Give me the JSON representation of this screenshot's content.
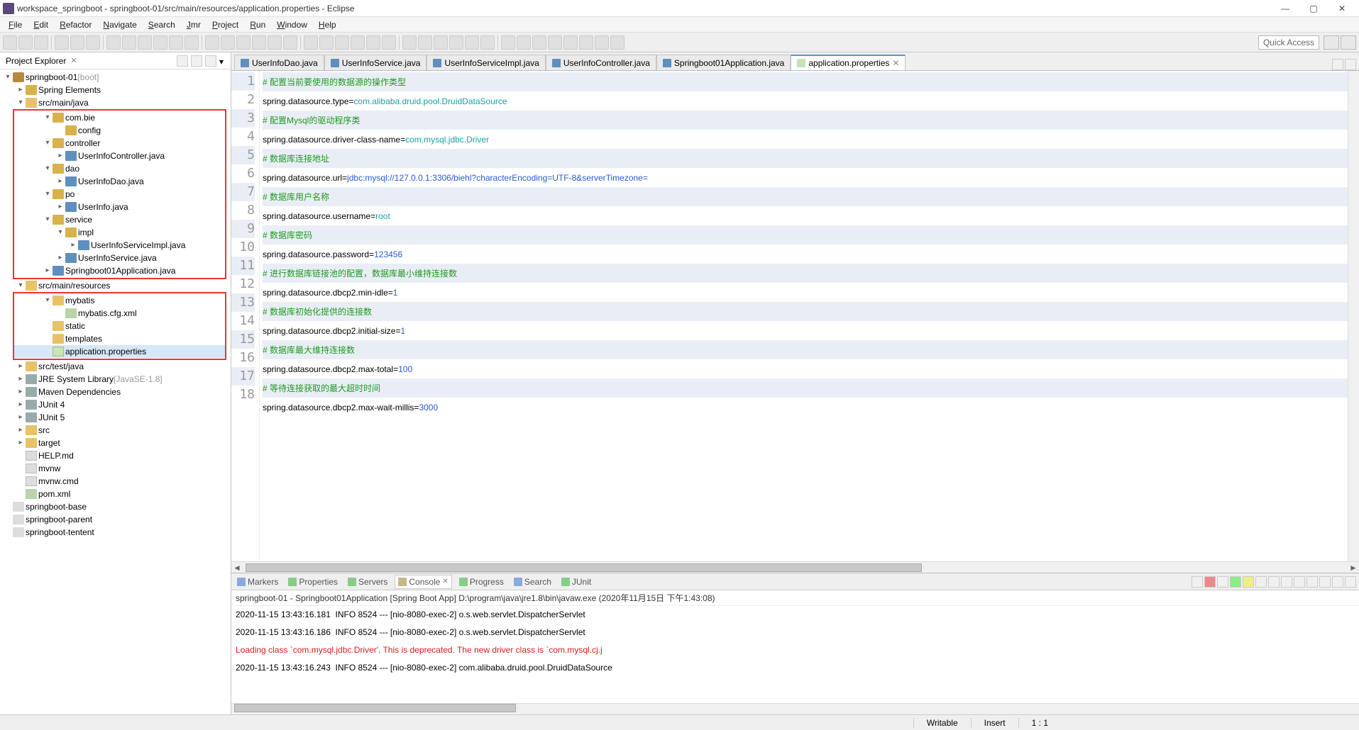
{
  "window": {
    "title": "workspace_springboot - springboot-01/src/main/resources/application.properties - Eclipse"
  },
  "menus": [
    "File",
    "Edit",
    "Refactor",
    "Navigate",
    "Search",
    "Jmr",
    "Project",
    "Run",
    "Window",
    "Help"
  ],
  "quick_access": "Quick Access",
  "project_explorer": {
    "title": "Project Explorer",
    "tree": [
      {
        "d": 0,
        "exp": "open",
        "icon": "proj",
        "label": "springboot-01",
        "suffix": " [boot]"
      },
      {
        "d": 1,
        "exp": "c",
        "icon": "pkg",
        "label": "Spring Elements"
      },
      {
        "d": 1,
        "exp": "open",
        "icon": "folder",
        "label": "src/main/java"
      },
      {
        "red_start": true
      },
      {
        "d": 2,
        "exp": "open",
        "icon": "pkg",
        "label": "com.bie"
      },
      {
        "d": 3,
        "exp": "",
        "icon": "pkg",
        "label": "config"
      },
      {
        "d": 2,
        "exp": "open",
        "icon": "pkg",
        "label": "controller"
      },
      {
        "d": 3,
        "exp": "c",
        "icon": "java",
        "label": "UserInfoController.java"
      },
      {
        "d": 2,
        "exp": "open",
        "icon": "pkg",
        "label": "dao"
      },
      {
        "d": 3,
        "exp": "c",
        "icon": "java",
        "label": "UserInfoDao.java"
      },
      {
        "d": 2,
        "exp": "open",
        "icon": "pkg",
        "label": "po"
      },
      {
        "d": 3,
        "exp": "c",
        "icon": "java",
        "label": "UserInfo.java"
      },
      {
        "d": 2,
        "exp": "open",
        "icon": "pkg",
        "label": "service"
      },
      {
        "d": 3,
        "exp": "open",
        "icon": "pkg",
        "label": "impl"
      },
      {
        "d": 4,
        "exp": "c",
        "icon": "java",
        "label": "UserInfoServiceImpl.java"
      },
      {
        "d": 3,
        "exp": "c",
        "icon": "java",
        "label": "UserInfoService.java"
      },
      {
        "d": 2,
        "exp": "c",
        "icon": "java",
        "label": "Springboot01Application.java"
      },
      {
        "red_end": true
      },
      {
        "d": 1,
        "exp": "open",
        "icon": "folder",
        "label": "src/main/resources"
      },
      {
        "red_start": true
      },
      {
        "d": 2,
        "exp": "open",
        "icon": "folder",
        "label": "mybatis"
      },
      {
        "d": 3,
        "exp": "",
        "icon": "xml",
        "label": "mybatis.cfg.xml"
      },
      {
        "d": 2,
        "exp": "",
        "icon": "folder",
        "label": "static"
      },
      {
        "d": 2,
        "exp": "",
        "icon": "folder",
        "label": "templates"
      },
      {
        "d": 2,
        "exp": "",
        "icon": "prop",
        "label": "application.properties",
        "sel": true
      },
      {
        "red_end": true
      },
      {
        "d": 1,
        "exp": "c",
        "icon": "folder",
        "label": "src/test/java"
      },
      {
        "d": 1,
        "exp": "c",
        "icon": "jar",
        "label": "JRE System Library",
        "suffix": " [JavaSE-1.8]"
      },
      {
        "d": 1,
        "exp": "c",
        "icon": "jar",
        "label": "Maven Dependencies"
      },
      {
        "d": 1,
        "exp": "c",
        "icon": "jar",
        "label": "JUnit 4"
      },
      {
        "d": 1,
        "exp": "c",
        "icon": "jar",
        "label": "JUnit 5"
      },
      {
        "d": 1,
        "exp": "c",
        "icon": "folder",
        "label": "src"
      },
      {
        "d": 1,
        "exp": "c",
        "icon": "folder",
        "label": "target"
      },
      {
        "d": 1,
        "exp": "",
        "icon": "file",
        "label": "HELP.md"
      },
      {
        "d": 1,
        "exp": "",
        "icon": "file",
        "label": "mvnw"
      },
      {
        "d": 1,
        "exp": "",
        "icon": "file",
        "label": "mvnw.cmd"
      },
      {
        "d": 1,
        "exp": "",
        "icon": "xml",
        "label": "pom.xml"
      },
      {
        "d": 0,
        "exp": "",
        "icon": "closed",
        "label": "springboot-base"
      },
      {
        "d": 0,
        "exp": "",
        "icon": "closed",
        "label": "springboot-parent"
      },
      {
        "d": 0,
        "exp": "",
        "icon": "closed",
        "label": "springboot-tentent"
      }
    ]
  },
  "tabs": [
    {
      "label": "UserInfoDao.java",
      "icon": "j"
    },
    {
      "label": "UserInfoService.java",
      "icon": "j"
    },
    {
      "label": "UserInfoServiceImpl.java",
      "icon": "j"
    },
    {
      "label": "UserInfoController.java",
      "icon": "j"
    },
    {
      "label": "Springboot01Application.java",
      "icon": "j"
    },
    {
      "label": "application.properties",
      "icon": "p",
      "active": true,
      "closeable": true
    }
  ],
  "code_lines": [
    {
      "n": 1,
      "hl": true,
      "segs": [
        {
          "c": "comment",
          "t": "# 配置当前要使用的数据源的操作类型"
        }
      ]
    },
    {
      "n": 2,
      "segs": [
        {
          "c": "key",
          "t": "spring.datasource.type"
        },
        {
          "c": "eq",
          "t": "="
        },
        {
          "c": "val-teal",
          "t": "com.alibaba.druid.pool.DruidDataSource"
        }
      ]
    },
    {
      "n": 3,
      "hl": true,
      "segs": [
        {
          "c": "comment",
          "t": "# 配置Mysql的驱动程序类"
        }
      ]
    },
    {
      "n": 4,
      "segs": [
        {
          "c": "key",
          "t": "spring.datasource.driver-class-name"
        },
        {
          "c": "eq",
          "t": "="
        },
        {
          "c": "val-teal",
          "t": "com.mysql.jdbc.Driver"
        }
      ]
    },
    {
      "n": 5,
      "hl": true,
      "segs": [
        {
          "c": "comment",
          "t": "# 数据库连接地址"
        }
      ]
    },
    {
      "n": 6,
      "segs": [
        {
          "c": "key",
          "t": "spring.datasource.url"
        },
        {
          "c": "eq",
          "t": "="
        },
        {
          "c": "val-blue",
          "t": "jdbc:mysql://127.0.0.1:3306/biehl?characterEncoding=UTF-8&serverTimezone="
        }
      ]
    },
    {
      "n": 7,
      "hl": true,
      "segs": [
        {
          "c": "comment",
          "t": "# 数据库用户名称"
        }
      ]
    },
    {
      "n": 8,
      "segs": [
        {
          "c": "key",
          "t": "spring.datasource.username"
        },
        {
          "c": "eq",
          "t": "="
        },
        {
          "c": "val-teal",
          "t": "root"
        }
      ]
    },
    {
      "n": 9,
      "hl": true,
      "segs": [
        {
          "c": "comment",
          "t": "# 数据库密码"
        }
      ]
    },
    {
      "n": 10,
      "segs": [
        {
          "c": "key",
          "t": "spring.datasource.password"
        },
        {
          "c": "eq",
          "t": "="
        },
        {
          "c": "val-blue",
          "t": "123456"
        }
      ]
    },
    {
      "n": 11,
      "hl": true,
      "segs": [
        {
          "c": "comment",
          "t": "# 进行数据库链接池的配置，数据库最小维持连接数"
        }
      ]
    },
    {
      "n": 12,
      "segs": [
        {
          "c": "key",
          "t": "spring.datasource.dbcp2.min-idle"
        },
        {
          "c": "eq",
          "t": "="
        },
        {
          "c": "val-blue",
          "t": "1"
        }
      ]
    },
    {
      "n": 13,
      "hl": true,
      "segs": [
        {
          "c": "comment",
          "t": "# 数据库初始化提供的连接数"
        }
      ]
    },
    {
      "n": 14,
      "segs": [
        {
          "c": "key",
          "t": "spring.datasource.dbcp2.initial-size"
        },
        {
          "c": "eq",
          "t": "="
        },
        {
          "c": "val-blue",
          "t": "1"
        }
      ]
    },
    {
      "n": 15,
      "hl": true,
      "segs": [
        {
          "c": "comment",
          "t": "# 数据库最大维持连接数"
        }
      ]
    },
    {
      "n": 16,
      "segs": [
        {
          "c": "key",
          "t": "spring.datasource.dbcp2.max-total"
        },
        {
          "c": "eq",
          "t": "="
        },
        {
          "c": "val-blue",
          "t": "100"
        }
      ]
    },
    {
      "n": 17,
      "hl": true,
      "segs": [
        {
          "c": "comment",
          "t": "# 等待连接获取的最大超时时间"
        }
      ]
    },
    {
      "n": 18,
      "segs": [
        {
          "c": "key",
          "t": "spring.datasource.dbcp2.max-wait-millis"
        },
        {
          "c": "eq",
          "t": "="
        },
        {
          "c": "val-blue",
          "t": "3000"
        }
      ]
    }
  ],
  "bottom_tabs": [
    {
      "label": "Markers",
      "icon": "blue"
    },
    {
      "label": "Properties",
      "icon": "green"
    },
    {
      "label": "Servers",
      "icon": "green"
    },
    {
      "label": "Console",
      "icon": "console",
      "active": true,
      "closeable": true
    },
    {
      "label": "Progress",
      "icon": "green"
    },
    {
      "label": "Search",
      "icon": "blue"
    },
    {
      "label": "JUnit",
      "icon": "green"
    }
  ],
  "console": {
    "header": "springboot-01 - Springboot01Application [Spring Boot App] D:\\program\\java\\jre1.8\\bin\\javaw.exe (2020年11月15日 下午1:43:08)",
    "lines": [
      {
        "t": "2020-11-15 13:43:16.181  INFO 8524 --- [nio-8080-exec-2] o.s.web.servlet.DispatcherServlet"
      },
      {
        "t": "2020-11-15 13:43:16.186  INFO 8524 --- [nio-8080-exec-2] o.s.web.servlet.DispatcherServlet"
      },
      {
        "t": "Loading class `com.mysql.jdbc.Driver'. This is deprecated. The new driver class is `com.mysql.cj.j",
        "err": true
      },
      {
        "t": "2020-11-15 13:43:16.243  INFO 8524 --- [nio-8080-exec-2] com.alibaba.druid.pool.DruidDataSource"
      }
    ]
  },
  "status": {
    "writable": "Writable",
    "mode": "Insert",
    "pos": "1 : 1"
  }
}
